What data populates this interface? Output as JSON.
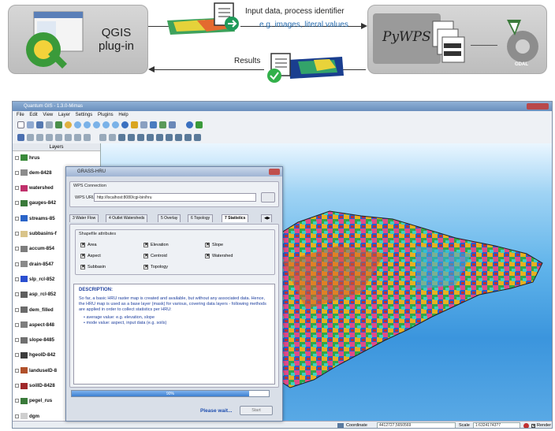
{
  "diagram": {
    "plugin_label_1": "QGIS",
    "plugin_label_2": "plug-in",
    "request_title": "Input data, process identifier",
    "request_sub": "e.g. images, literal values",
    "response_title": "Results",
    "server_label": "PyWPS",
    "gdal_label": "GDAL"
  },
  "window": {
    "title": "Quantum GIS - 1.3.0-Mimas",
    "menu": [
      "File",
      "Edit",
      "View",
      "Layer",
      "Settings",
      "Plugins",
      "Help"
    ]
  },
  "layers_panel": {
    "header": "Layers",
    "items": [
      {
        "name": "hrus",
        "color": "#3a8a3a"
      },
      {
        "name": "dem-8428",
        "color": "#8c8c8c"
      },
      {
        "name": "watershed",
        "color": "#c0306b"
      },
      {
        "name": "gauges-842",
        "color": "#3a7a3a"
      },
      {
        "name": "streams-85",
        "color": "#2a64c8"
      },
      {
        "name": "subbasins-f",
        "color": "#d9c48a"
      },
      {
        "name": "accum-854",
        "color": "#7d7d7d"
      },
      {
        "name": "drain-8547",
        "color": "#8a8a8a"
      },
      {
        "name": "slp_rcl-852",
        "color": "#2b4fd0"
      },
      {
        "name": "asp_rcl-852",
        "color": "#5f5f5f"
      },
      {
        "name": "dem_filled",
        "color": "#6b6b6b"
      },
      {
        "name": "aspect-848",
        "color": "#7e7e7e"
      },
      {
        "name": "slope-8485",
        "color": "#707070"
      },
      {
        "name": "hgeoID-842",
        "color": "#3c3c3c"
      },
      {
        "name": "landuseID-8",
        "color": "#b0502a"
      },
      {
        "name": "soilID-8428",
        "color": "#a0282a"
      },
      {
        "name": "pegel_rus",
        "color": "#3a7a3a"
      },
      {
        "name": "dgm",
        "color": "#cfcfcf"
      }
    ]
  },
  "dialog": {
    "title": "GRASS-HRU",
    "connection_group": "WPS Connection",
    "url_label": "WPS URL:",
    "url_value": "http://localhost:8080/cgi-bin/hru",
    "tabs": [
      "3 Water Flow",
      "4 Outlet Watersheds",
      "5 Overlay",
      "6 Topology",
      "7 Statistics"
    ],
    "shapefile_group": "Shapefile attributes",
    "attributes": [
      "Area",
      "Elevation",
      "Slope",
      "Aspect",
      "Centroid",
      "Watershed",
      "Subbasin",
      "Topology"
    ],
    "description_heading": "DESCRIPTION:",
    "description_text": "So far, a basic HRU raster map is created and available, but without any associated data. Hence, the HRU map is used as a base layer (mask) for various, covering data layers - following methods are applied in order to collect statistics per HRU:",
    "bullets": [
      "average value: e.g. elevation, slope",
      "mode value: aspect, input data (e.g. soils)"
    ],
    "progress_text": "90%",
    "progress_value": 0.9,
    "wait_text": "Please wait...",
    "start_label": "Start"
  },
  "status": {
    "coordinate_label": "Coordinate",
    "coordinate_value": "4412727,5650569",
    "scale_label": "Scale",
    "scale_value": "1:63241743?7",
    "render_label": "Render"
  }
}
